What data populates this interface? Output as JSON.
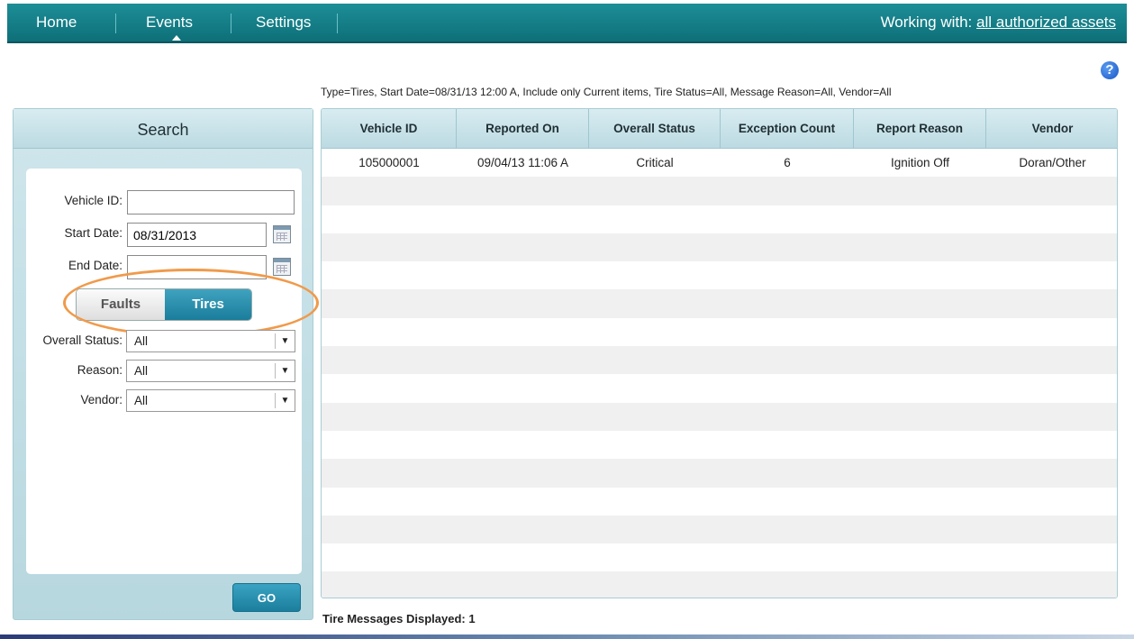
{
  "nav": {
    "items": [
      "Home",
      "Events",
      "Settings"
    ],
    "working_label": "Working with:",
    "working_link": "all authorized assets"
  },
  "help_icon": "?",
  "filter_summary": "Type=Tires, Start Date=08/31/13 12:00 A, Include only Current items, Tire Status=All, Message Reason=All, Vendor=All",
  "search": {
    "title": "Search",
    "vehicle_id_label": "Vehicle ID:",
    "vehicle_id_value": "",
    "start_date_label": "Start Date:",
    "start_date_value": "08/31/2013",
    "end_date_label": "End Date:",
    "end_date_value": "",
    "toggle": {
      "faults": "Faults",
      "tires": "Tires",
      "selected": "Tires"
    },
    "overall_status_label": "Overall Status:",
    "overall_status_value": "All",
    "reason_label": "Reason:",
    "reason_value": "All",
    "vendor_label": "Vendor:",
    "vendor_value": "All",
    "go_label": "GO"
  },
  "grid": {
    "columns": [
      "Vehicle ID",
      "Reported On",
      "Overall Status",
      "Exception Count",
      "Report Reason",
      "Vendor"
    ],
    "rows": [
      [
        "105000001",
        "09/04/13 11:06 A",
        "Critical",
        "6",
        "Ignition Off",
        "Doran/Other"
      ]
    ]
  },
  "footer": {
    "count_text": "Tire Messages Displayed: 1"
  },
  "colors": {
    "nav": "#0e6f78",
    "accent": "#1a7d9b",
    "highlight": "#f09a4a"
  }
}
